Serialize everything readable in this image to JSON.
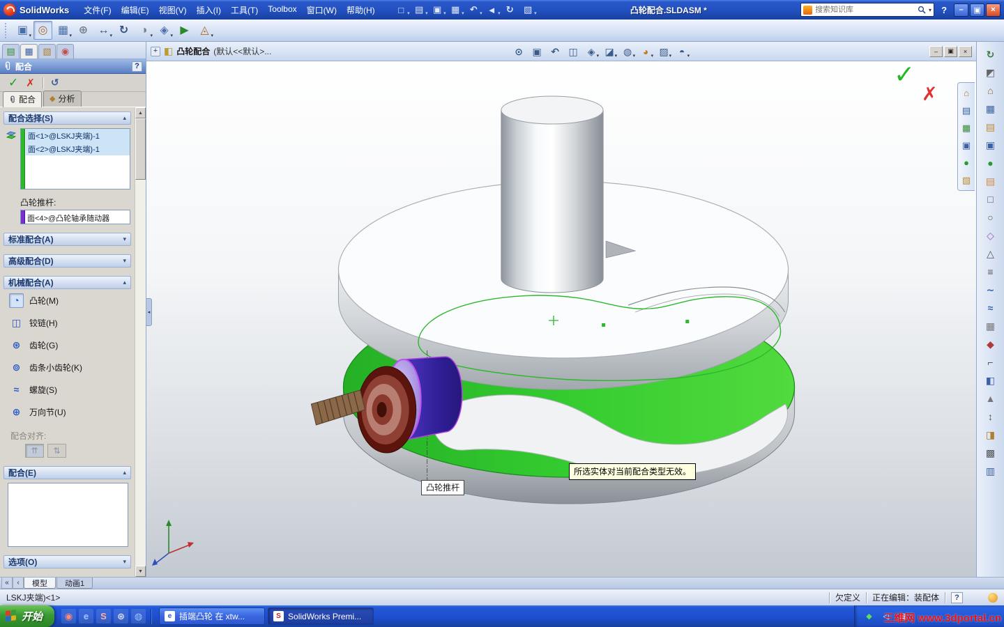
{
  "colors": {
    "selection_green": "#2db82d",
    "cam_face_green": "#35cc30",
    "follower_purple": "#4a34bc",
    "tooltip_bg": "#ffffe1",
    "taskbar_blue": "#1e4fd0"
  },
  "titlebar": {
    "app_name": "SolidWorks",
    "document_title": "凸轮配合.SLDASM *",
    "help_glyph": "?",
    "menus": [
      {
        "name": "menu-file",
        "label": "文件(F)"
      },
      {
        "name": "menu-edit",
        "label": "编辑(E)"
      },
      {
        "name": "menu-view",
        "label": "视图(V)"
      },
      {
        "name": "menu-insert",
        "label": "插入(I)"
      },
      {
        "name": "menu-tools",
        "label": "工具(T)"
      },
      {
        "name": "menu-toolbox",
        "label": "Toolbox"
      },
      {
        "name": "menu-window",
        "label": "窗口(W)"
      },
      {
        "name": "menu-help",
        "label": "帮助(H)"
      }
    ],
    "quick_icons": [
      {
        "name": "new-document-icon",
        "glyph": "□",
        "drop": "▾"
      },
      {
        "name": "open-document-icon",
        "glyph": "▤",
        "drop": "▾"
      },
      {
        "name": "save-icon",
        "glyph": "▣",
        "drop": "▾"
      },
      {
        "name": "print-icon",
        "glyph": "▦",
        "drop": "▾"
      },
      {
        "name": "undo-icon",
        "glyph": "↶",
        "drop": "▾"
      },
      {
        "name": "select-cursor-icon",
        "glyph": "◄",
        "drop": "▾"
      },
      {
        "name": "rebuild-icon",
        "glyph": "↻",
        "drop": ""
      },
      {
        "name": "options-icon",
        "glyph": "▧",
        "drop": "▾"
      }
    ],
    "search": {
      "placeholder": "搜索知识库"
    },
    "win": {
      "minimize": "–",
      "restore": "▣",
      "close": "×"
    }
  },
  "assembly_toolbar": {
    "items": [
      {
        "name": "insert-components-icon",
        "glyph": "▣",
        "color": "#4a6fa8",
        "drop": "▾"
      },
      {
        "name": "mate-icon",
        "glyph": "◎",
        "color": "#b06a20",
        "drop": "",
        "pressed": true
      },
      {
        "name": "linear-component-pattern-icon",
        "glyph": "▦",
        "color": "#4a6fa8",
        "drop": "▾"
      },
      {
        "name": "smart-fasteners-icon",
        "glyph": "⊕",
        "color": "#77828f",
        "drop": ""
      },
      {
        "name": "move-component-icon",
        "glyph": "↔",
        "color": "#33507e",
        "drop": "▾"
      },
      {
        "name": "rotate-component-icon",
        "glyph": "↻",
        "color": "#33507e",
        "drop": ""
      },
      {
        "name": "hide-show-components-icon",
        "glyph": "◑",
        "color": "#77828f",
        "drop": "▾"
      },
      {
        "name": "assembly-features-icon",
        "glyph": "◈",
        "color": "#4a6fa8",
        "drop": "▾"
      },
      {
        "name": "new-motion-study-icon",
        "glyph": "▶",
        "color": "#2a8a2a",
        "drop": ""
      },
      {
        "name": "exploded-view-icon",
        "glyph": "◬",
        "color": "#b06a20",
        "drop": "▾"
      }
    ]
  },
  "view_toolbar": {
    "items": [
      {
        "name": "zoom-fit-icon",
        "glyph": "⊙",
        "color": "#3a5a8a",
        "drop": ""
      },
      {
        "name": "zoom-area-icon",
        "glyph": "▣",
        "color": "#3a5a8a",
        "drop": ""
      },
      {
        "name": "previous-view-icon",
        "glyph": "↶",
        "color": "#3a5a8a",
        "drop": ""
      },
      {
        "name": "section-view-icon",
        "glyph": "◫",
        "color": "#3a5a8a",
        "drop": ""
      },
      {
        "name": "view-orientation-icon",
        "glyph": "◈",
        "color": "#3a5a8a",
        "drop": "▾"
      },
      {
        "name": "display-style-icon",
        "glyph": "◪",
        "color": "#3a5a8a",
        "drop": "▾"
      },
      {
        "name": "hide-show-items-icon",
        "glyph": "◍",
        "color": "#3a5a8a",
        "drop": "▾"
      },
      {
        "name": "edit-appearance-icon",
        "glyph": "◕",
        "color": "#c07a20",
        "drop": "▾"
      },
      {
        "name": "apply-scene-icon",
        "glyph": "▨",
        "color": "#3a5a8a",
        "drop": "▾"
      },
      {
        "name": "view-settings-icon",
        "glyph": "◓",
        "color": "#3a5a8a",
        "drop": "▾"
      }
    ]
  },
  "panel": {
    "title": "配合",
    "help_glyph": "?",
    "ok_glyph": "✓",
    "cancel_glyph": "✗",
    "undo_glyph": "↺",
    "scroll_up": "▲",
    "scroll_down": "▼",
    "collapse_glyph": "◂",
    "top_tabs": [
      {
        "name": "featuremanager-tab-icon",
        "glyph": "▤",
        "color": "#3a8a3a"
      },
      {
        "name": "propertymanager-tab-icon",
        "glyph": "▦",
        "color": "#3a62a8",
        "pressed": true
      },
      {
        "name": "configurationmanager-tab-icon",
        "glyph": "▧",
        "color": "#b08030"
      },
      {
        "name": "dimxpertmanager-tab-icon",
        "glyph": "◉",
        "color": "#c05050"
      }
    ],
    "tabs": [
      {
        "label": "配合"
      },
      {
        "label": "分析"
      }
    ],
    "sections": {
      "selections": {
        "title": "配合选择(S)",
        "chev": "▴",
        "items": [
          "面<1>@LSKJ夹端)-1",
          "面<2>@LSKJ夹端)-1"
        ],
        "follower_label": "凸轮推杆:",
        "follower_value": "面<4>@凸轮轴承随动器"
      },
      "standard_title": "标准配合(A)",
      "standard_chev": "▾",
      "advanced_title": "高级配合(D)",
      "advanced_chev": "▾",
      "mechanical": {
        "title": "机械配合(A)",
        "chev": "▴",
        "items": [
          {
            "name": "cam-mate-item",
            "glyph": "◔",
            "label": "凸轮(M)",
            "selected": true
          },
          {
            "name": "hinge-mate-item",
            "glyph": "◫",
            "label": "铰链(H)"
          },
          {
            "name": "gear-mate-item",
            "glyph": "⊛",
            "label": "齿轮(G)"
          },
          {
            "name": "rack-pinion-mate-item",
            "glyph": "⊚",
            "label": "齿条小齿轮(K)"
          },
          {
            "name": "screw-mate-item",
            "glyph": "≈",
            "label": "螺旋(S)"
          },
          {
            "name": "universal-joint-mate-item",
            "glyph": "⊕",
            "label": "万向节(U)"
          }
        ],
        "align_label": "配合对齐:",
        "align_buttons": [
          {
            "name": "aligned-button",
            "glyph": "⇈",
            "pressed": true
          },
          {
            "name": "anti-aligned-button",
            "glyph": "⇅"
          }
        ]
      },
      "mates_title": "配合(E)",
      "mates_chev": "▴",
      "options_title": "选项(O)",
      "options_chev": "▾"
    }
  },
  "viewport": {
    "plus_glyph": "+",
    "doc_tab": {
      "title": "凸轮配合",
      "config": "(默认<<默认>..."
    },
    "tooltip": "所选实体对当前配合类型无效。",
    "callout": "凸轮推杆"
  },
  "taskpane": {
    "items": [
      {
        "name": "solidworks-resources-icon",
        "glyph": "⌂",
        "color": "#b08030"
      },
      {
        "name": "design-library-icon",
        "glyph": "▤",
        "color": "#3a62a8"
      },
      {
        "name": "file-explorer-icon",
        "glyph": "▦",
        "color": "#3a8a3a"
      },
      {
        "name": "view-palette-icon",
        "glyph": "▣",
        "color": "#3a62a8"
      },
      {
        "name": "appearances-icon",
        "glyph": "●",
        "color": "#2a9a2a"
      },
      {
        "name": "custom-properties-icon",
        "glyph": "▧",
        "color": "#c08a30"
      }
    ]
  },
  "dock": {
    "items": [
      {
        "name": "redo-icon",
        "glyph": "↻",
        "color": "#3a7a3a"
      },
      {
        "name": "half-section-icon",
        "glyph": "◩",
        "color": "#666666"
      },
      {
        "name": "home-icon",
        "glyph": "⌂",
        "color": "#8a6a20"
      },
      {
        "name": "grid-icon",
        "glyph": "▦",
        "color": "#3a62a8"
      },
      {
        "name": "library-folder-icon",
        "glyph": "▤",
        "color": "#c08a30"
      },
      {
        "name": "pattern-icon",
        "glyph": "▣",
        "color": "#3a62a8"
      },
      {
        "name": "sphere-icon",
        "glyph": "●",
        "color": "#2a9a2a"
      },
      {
        "name": "folder-icon",
        "glyph": "▤",
        "color": "#d08a40"
      },
      {
        "name": "rect-tool-icon",
        "glyph": "□",
        "color": "#555555"
      },
      {
        "name": "circle-tool-icon",
        "glyph": "○",
        "color": "#555555"
      },
      {
        "name": "diamond-tool-icon",
        "glyph": "◇",
        "color": "#9a5ac0"
      },
      {
        "name": "triangle-tool-icon",
        "glyph": "△",
        "color": "#555555"
      },
      {
        "name": "list-icon",
        "glyph": "≡",
        "color": "#555555"
      },
      {
        "name": "spline-icon",
        "glyph": "∼",
        "color": "#3a62a8"
      },
      {
        "name": "wave-icon",
        "glyph": "≈",
        "color": "#3a62a8"
      },
      {
        "name": "mesh-icon",
        "glyph": "▦",
        "color": "#777777"
      },
      {
        "name": "ruby-icon",
        "glyph": "◆",
        "color": "#b03a3a"
      },
      {
        "name": "corner-icon",
        "glyph": "⌐",
        "color": "#555555"
      },
      {
        "name": "half-square-icon",
        "glyph": "◧",
        "color": "#3a62a8"
      },
      {
        "name": "arrow-up-icon",
        "glyph": "▲",
        "color": "#777777"
      },
      {
        "name": "updown-icon",
        "glyph": "↕",
        "color": "#555555"
      },
      {
        "name": "shade-icon",
        "glyph": "◨",
        "color": "#b08030"
      },
      {
        "name": "hatch-icon",
        "glyph": "▩",
        "color": "#555555"
      },
      {
        "name": "panel-icon",
        "glyph": "▥",
        "color": "#3a62a8"
      }
    ]
  },
  "tabsrow": {
    "nav": [
      "«",
      "‹"
    ],
    "tabs": [
      {
        "name": "model-tab",
        "label": "模型",
        "active": true
      },
      {
        "name": "motion-study-tab",
        "label": "动画1"
      }
    ]
  },
  "statusbar": {
    "left_text": "LSKJ夹端)<1>",
    "status": "欠定义",
    "editing": "正在编辑：装配体",
    "help_glyph": "?"
  },
  "taskbar": {
    "start_label": "开始",
    "quick_launch": [
      {
        "name": "media-player-icon",
        "glyph": "◉",
        "color": "#ff8a70"
      },
      {
        "name": "internet-explorer-icon",
        "glyph": "e",
        "color": "#9ec4ff"
      },
      {
        "name": "solidworks-icon",
        "glyph": "S",
        "color": "#ffb0a0"
      },
      {
        "name": "settings-gear-icon",
        "glyph": "⊛",
        "color": "#d8e0f0"
      },
      {
        "name": "browser-icon",
        "glyph": "◍",
        "color": "#9ec4ff"
      }
    ],
    "tasks": [
      {
        "label": "插端凸轮 在 xtw...",
        "icon_glyph": "e"
      },
      {
        "label": "SolidWorks Premi...",
        "icon_glyph": "S",
        "pressed": true
      }
    ],
    "tray_icons": [
      {
        "name": "tray-shield-icon",
        "glyph": "◆",
        "color": "#5ae05a"
      },
      {
        "name": "tray-volume-icon",
        "glyph": "◁",
        "color": "#e8eefc"
      },
      {
        "name": "tray-network-icon",
        "glyph": "▦",
        "color": "#e8eefc"
      }
    ],
    "watermark": "三维网 www.3dportal.cn"
  }
}
